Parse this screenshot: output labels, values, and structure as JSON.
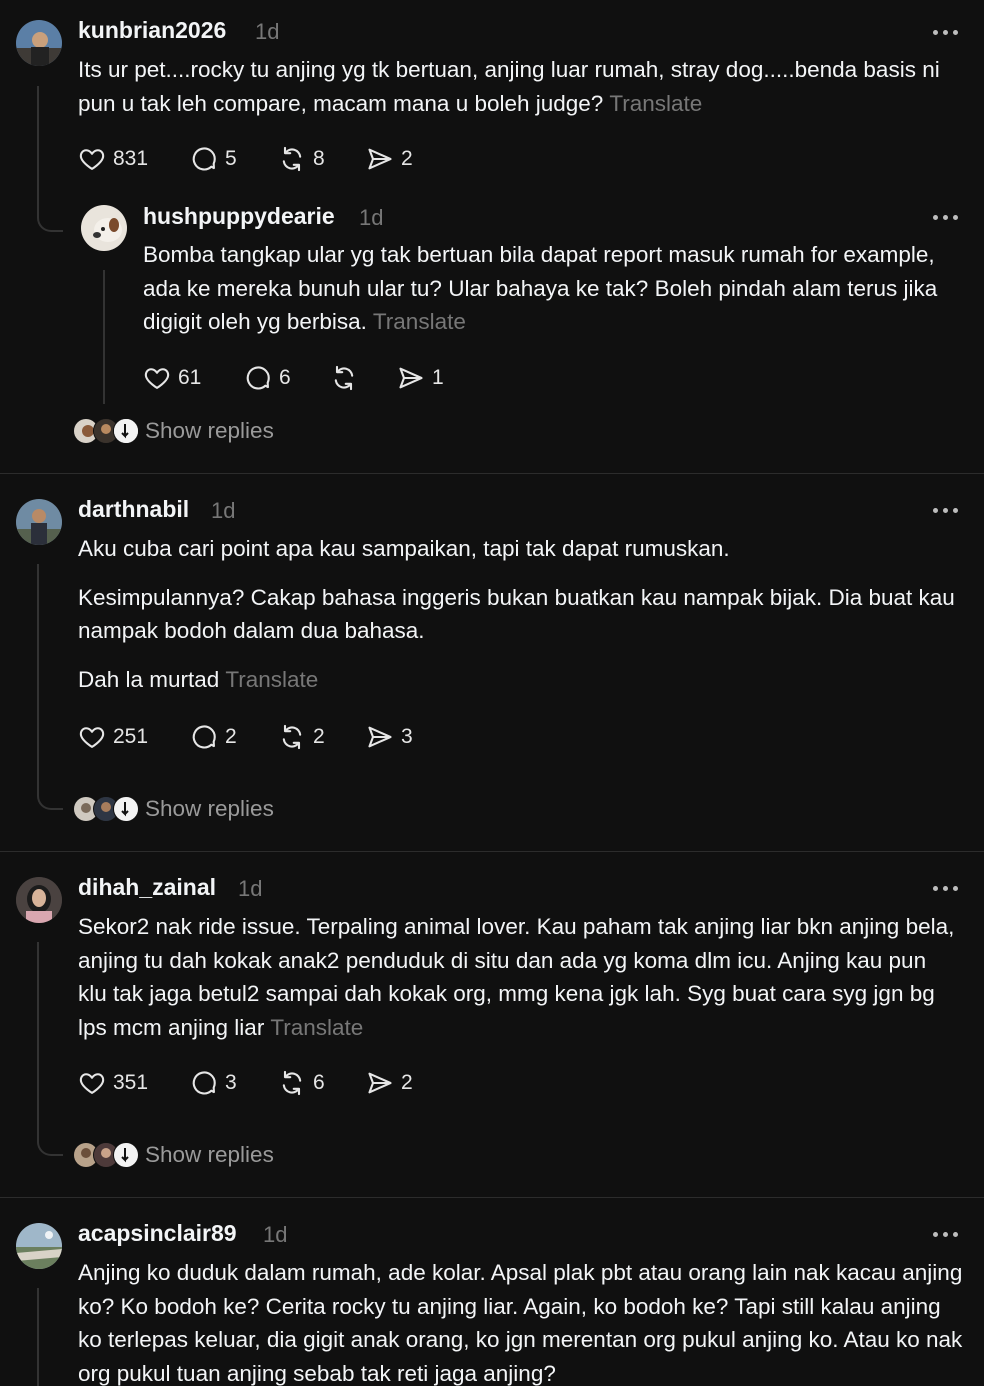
{
  "posts": [
    {
      "username": "kunbrian2026",
      "time": "1d",
      "paragraphs": [
        "Its ur pet....rocky tu anjing yg tk bertuan, anjing luar rumah, stray dog.....benda basis ni pun u tak leh compare, macam mana u boleh judge?"
      ],
      "translate": "Translate",
      "likes": "831",
      "replies": "5",
      "reposts": "8",
      "shares": "2"
    },
    {
      "username": "hushpuppydearie",
      "time": "1d",
      "paragraphs": [
        "Bomba tangkap ular yg tak bertuan bila dapat report masuk rumah for example, ada ke mereka bunuh ular tu? Ular bahaya ke tak? Boleh pindah alam terus jika digigit oleh yg berbisa."
      ],
      "translate": "Translate",
      "likes": "61",
      "replies": "6",
      "reposts": "",
      "shares": "1",
      "show_replies": "Show replies"
    },
    {
      "username": "darthnabil",
      "time": "1d",
      "paragraphs": [
        "Aku cuba cari point apa kau sampaikan, tapi tak dapat rumuskan.",
        "Kesimpulannya? Cakap bahasa inggeris bukan buatkan kau nampak bijak. Dia buat kau nampak bodoh dalam dua bahasa.",
        "Dah la murtad"
      ],
      "translate": "Translate",
      "likes": "251",
      "replies": "2",
      "reposts": "2",
      "shares": "3",
      "show_replies": "Show replies"
    },
    {
      "username": "dihah_zainal",
      "time": "1d",
      "paragraphs": [
        "Sekor2 nak ride issue. Terpaling animal lover. Kau paham tak anjing liar bkn anjing bela, anjing tu dah kokak anak2 penduduk di situ dan ada yg koma dlm icu. Anjing kau pun klu tak jaga betul2 sampai dah kokak org, mmg kena jgk lah. Syg buat cara syg jgn bg lps mcm anjing liar"
      ],
      "translate": "Translate",
      "likes": "351",
      "replies": "3",
      "reposts": "6",
      "shares": "2",
      "show_replies": "Show replies"
    },
    {
      "username": "acapsinclair89",
      "time": "1d",
      "paragraphs": [
        "Anjing ko duduk dalam rumah, ade kolar. Apsal plak pbt atau orang lain nak kacau anjing ko? Ko bodoh ke? Cerita rocky tu anjing liar. Again, ko bodoh ke? Tapi still kalau anjing ko terlepas keluar, dia gigit anak orang, ko jgn merentan org pukul anjing ko. Atau ko nak org pukul tuan anjing sebab tak reti jaga anjing?"
      ]
    }
  ],
  "icons": {
    "like": "heart-icon",
    "reply": "comment-icon",
    "repost": "repost-icon",
    "share": "share-icon",
    "more": "more-icon"
  }
}
